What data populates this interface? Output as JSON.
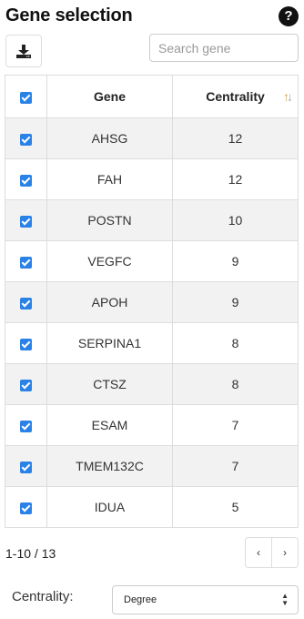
{
  "header": {
    "title": "Gene selection",
    "help_icon": "question-circle-icon"
  },
  "toolbar": {
    "download_icon": "download-icon",
    "search_placeholder": "Search gene"
  },
  "table": {
    "columns": [
      "",
      "Gene",
      "Centrality"
    ],
    "sort_icon": "sort-arrows-icon",
    "header_checked": true,
    "rows": [
      {
        "checked": true,
        "gene": "AHSG",
        "centrality": "12"
      },
      {
        "checked": true,
        "gene": "FAH",
        "centrality": "12"
      },
      {
        "checked": true,
        "gene": "POSTN",
        "centrality": "10"
      },
      {
        "checked": true,
        "gene": "VEGFC",
        "centrality": "9"
      },
      {
        "checked": true,
        "gene": "APOH",
        "centrality": "9"
      },
      {
        "checked": true,
        "gene": "SERPINA1",
        "centrality": "8"
      },
      {
        "checked": true,
        "gene": "CTSZ",
        "centrality": "8"
      },
      {
        "checked": true,
        "gene": "ESAM",
        "centrality": "7"
      },
      {
        "checked": true,
        "gene": "TMEM132C",
        "centrality": "7"
      },
      {
        "checked": true,
        "gene": "IDUA",
        "centrality": "5"
      }
    ]
  },
  "pagination": {
    "info": "1-10 / 13",
    "prev": "‹",
    "next": "›"
  },
  "centrality": {
    "label": "Centrality:",
    "selected": "Degree"
  },
  "colors": {
    "checkbox": "#2a82e6",
    "stripe": "#f2f2f2",
    "border": "#dddddd"
  }
}
